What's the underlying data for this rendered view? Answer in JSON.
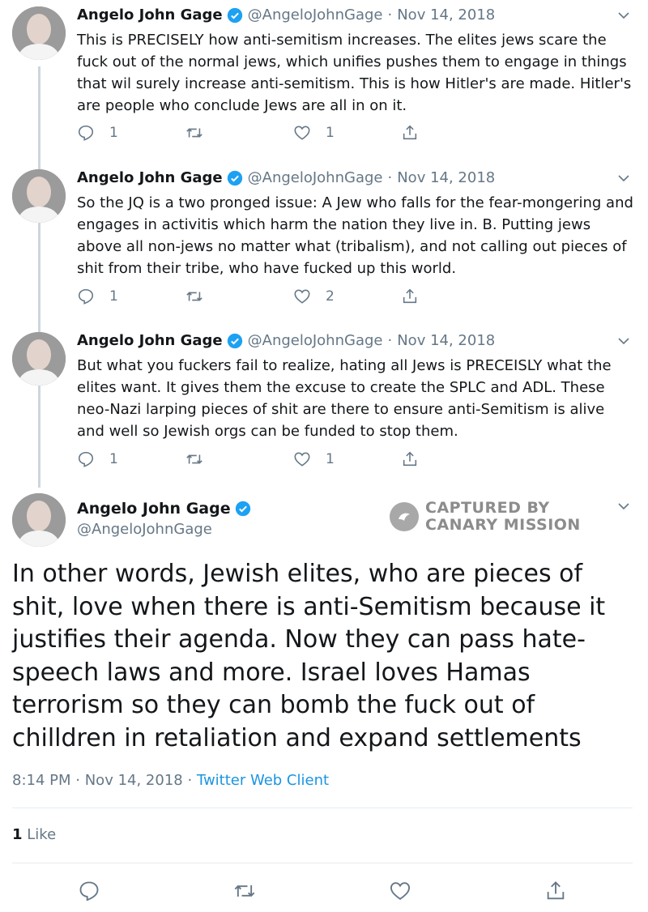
{
  "author": {
    "name": "Angelo John Gage",
    "handle": "@AngeloJohnGage"
  },
  "thread": [
    {
      "date": "Nov 14, 2018",
      "text": "This is PRECISELY how anti-semitism increases. The elites jews scare the fuck out of the normal jews, which unifies pushes them to engage in things that wil surely increase anti-semitism. This is how Hitler's are made. Hitler's are people who conclude Jews are all in on it.",
      "replies": "1",
      "retweets": "",
      "likes": "1"
    },
    {
      "date": "Nov 14, 2018",
      "text": "So the JQ is a two pronged issue: A Jew who falls for the fear-mongering and engages in activitis which harm the nation they live in. B. Putting jews above all non-jews no matter what (tribalism), and not calling out pieces of shit from their tribe, who have fucked up this world.",
      "replies": "1",
      "retweets": "",
      "likes": "2"
    },
    {
      "date": "Nov 14, 2018",
      "text": "But what you fuckers fail to realize, hating all Jews is PRECEISLY what the elites want. It gives them the excuse to create the SPLC and ADL. These neo-Nazi larping pieces of shit are there to ensure anti-Semitism is alive and well so Jewish orgs can be funded to stop them.",
      "replies": "1",
      "retweets": "",
      "likes": "1"
    }
  ],
  "main_tweet": {
    "text": "In other words, Jewish elites, who are pieces of shit, love when there is anti-Semitism because it justifies their agenda. Now they can pass hate-speech laws and more. Israel loves Hamas terrorism so they can bomb the fuck out of chilldren in retaliation and expand settlements",
    "time": "8:14 PM",
    "date": "Nov 14, 2018",
    "client": "Twitter Web Client",
    "likes_count": "1",
    "likes_label": "Like"
  },
  "watermark": {
    "line1": "CAPTURED BY",
    "line2": "CANARY MISSION"
  },
  "icons": {
    "reply": "reply-icon",
    "retweet": "retweet-icon",
    "like": "heart-icon",
    "share": "share-icon",
    "verified": "verified-badge-icon",
    "caret": "chevron-down-icon"
  },
  "colors": {
    "text": "#14171a",
    "secondary": "#657786",
    "link": "#1b95e0",
    "verified": "#1da1f2",
    "thread_line": "#ccd6dd"
  }
}
